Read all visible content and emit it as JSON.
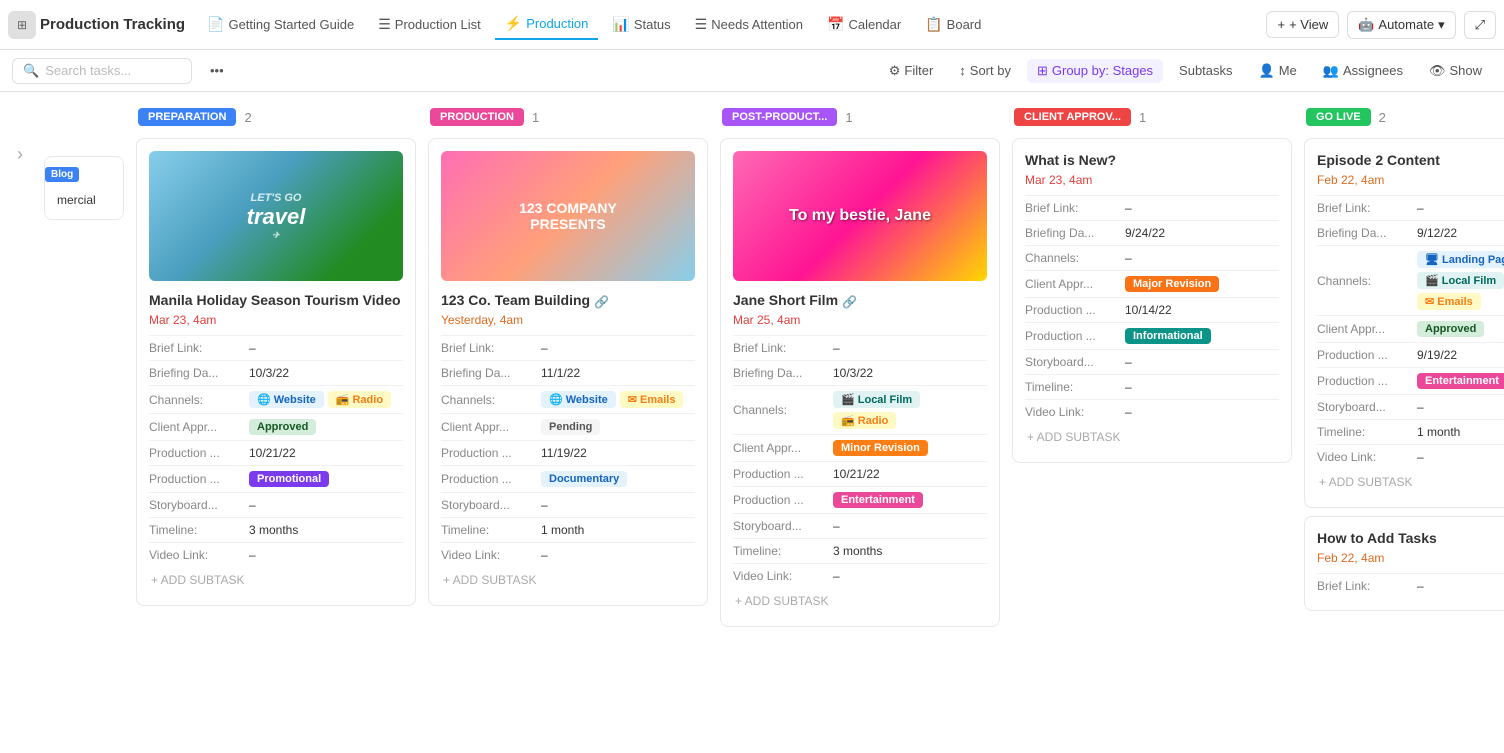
{
  "app": {
    "title": "Production Tracking",
    "logo_icon": "☰"
  },
  "nav": {
    "tabs": [
      {
        "id": "getting-started",
        "label": "Getting Started Guide",
        "icon": "📄",
        "active": false
      },
      {
        "id": "production-list",
        "label": "Production List",
        "icon": "☰",
        "active": false
      },
      {
        "id": "production",
        "label": "Production",
        "icon": "⚡",
        "active": true
      },
      {
        "id": "status",
        "label": "Status",
        "icon": "📊",
        "active": false
      },
      {
        "id": "needs-attention",
        "label": "Needs Attention",
        "icon": "☰",
        "active": false
      },
      {
        "id": "calendar",
        "label": "Calendar",
        "icon": "📅",
        "active": false
      },
      {
        "id": "board",
        "label": "Board",
        "icon": "📋",
        "active": false
      }
    ],
    "view_label": "+ View",
    "automate_label": "Automate"
  },
  "toolbar": {
    "search_placeholder": "Search tasks...",
    "more_icon": "•••",
    "filter_label": "Filter",
    "sort_label": "Sort by",
    "group_label": "Group by: Stages",
    "subtasks_label": "Subtasks",
    "me_label": "Me",
    "assignees_label": "Assignees",
    "show_label": "Show"
  },
  "columns": [
    {
      "id": "preparation",
      "label": "PREPARATION",
      "color": "#3b82f6",
      "count": 2,
      "cards": []
    },
    {
      "id": "production",
      "label": "PRODUCTION",
      "color": "#ec4899",
      "count": 1,
      "cards": [
        {
          "id": "123-team-building",
          "title": "123 Co. Team Building",
          "has_link": true,
          "date": "Yesterday, 4am",
          "date_color": "orange",
          "brief_link": "–",
          "briefing_date": "11/1/22",
          "channels": [
            "Website",
            "Emails"
          ],
          "client_appr": "Pending",
          "client_appr_type": "gray",
          "production_date": "11/19/22",
          "production_type": "Documentary",
          "production_type_color": "blue",
          "storyboard": "–",
          "timeline": "1 month",
          "video_link": "–",
          "image_type": "company"
        }
      ]
    },
    {
      "id": "post-production",
      "label": "POST-PRODUCT...",
      "color": "#a855f7",
      "count": 1,
      "cards": [
        {
          "id": "jane-short-film",
          "title": "Jane Short Film",
          "has_link": true,
          "date": "Mar 25, 4am",
          "date_color": "red",
          "brief_link": "–",
          "briefing_date": "10/3/22",
          "channels": [
            "Local Film",
            "Radio"
          ],
          "client_appr": "Minor Revision",
          "client_appr_type": "orange",
          "production_date": "10/21/22",
          "production_type": "Entertainment",
          "production_type_color": "pink",
          "storyboard": "–",
          "timeline": "3 months",
          "video_link": "–",
          "image_type": "jane"
        }
      ]
    },
    {
      "id": "client-approval",
      "label": "CLIENT APPROV...",
      "color": "#ef4444",
      "count": 1,
      "cards": [
        {
          "id": "what-is-new",
          "title": "What is New?",
          "has_link": false,
          "date": "Mar 23, 4am",
          "date_color": "red",
          "brief_link": "–",
          "briefing_date": "9/24/22",
          "channels": [
            "–"
          ],
          "client_appr": "Major Revision",
          "client_appr_type": "orange-red",
          "production_date_label": "Production ...",
          "production_date": "10/14/22",
          "production_type_label": "Production ...",
          "production_type": "Informational",
          "production_type_color": "teal",
          "storyboard": "–",
          "timeline": "–",
          "video_link": "–"
        }
      ]
    },
    {
      "id": "go-live",
      "label": "GO LIVE",
      "color": "#22c55e",
      "count": 2,
      "cards": [
        {
          "id": "episode-2-content",
          "title": "Episode 2 Content",
          "has_link": false,
          "date": "Feb 22, 4am",
          "date_color": "orange",
          "brief_link": "–",
          "briefing_date": "9/12/22",
          "channels": [
            "Landing Pages",
            "Local Film",
            "Emails"
          ],
          "client_appr": "Approved",
          "client_appr_type": "green",
          "production_date": "9/19/22",
          "production_type": "Entertainment",
          "production_type_color": "pink",
          "storyboard": "–",
          "timeline": "1 month",
          "video_link": "–"
        },
        {
          "id": "how-to-add-tasks",
          "title": "How to Add Tasks",
          "has_link": false,
          "date": "Feb 22, 4am",
          "date_color": "orange",
          "brief_link": "–",
          "briefing_date": ""
        }
      ]
    }
  ],
  "left_partial": {
    "label": "mercial",
    "badge": "Blog",
    "badge_color": "#3b82f6"
  },
  "manila_card": {
    "title": "Manila Holiday Season Tourism Video",
    "has_link": true,
    "date": "Mar 23, 4am",
    "date_color": "red",
    "brief_link": "–",
    "briefing_date": "10/3/22",
    "channels": [
      "Website",
      "Radio"
    ],
    "client_appr": "Approved",
    "client_appr_type": "green",
    "production_date": "10/21/22",
    "production_type": "Promotional",
    "production_type_color": "purple",
    "storyboard": "–",
    "timeline": "3 months",
    "video_link": "–"
  }
}
